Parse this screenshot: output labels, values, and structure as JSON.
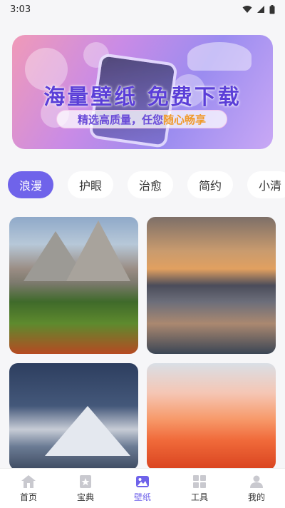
{
  "status": {
    "time": "3:03"
  },
  "banner": {
    "title": "海量壁纸 免费下载",
    "subtitle_main": "精选高质量，任您",
    "subtitle_highlight": "随心畅享"
  },
  "tabs": [
    {
      "label": "浪漫",
      "active": true
    },
    {
      "label": "护眼",
      "active": false
    },
    {
      "label": "治愈",
      "active": false
    },
    {
      "label": "简约",
      "active": false
    },
    {
      "label": "小清",
      "active": false
    }
  ],
  "bottom_nav": [
    {
      "label": "首页",
      "icon": "home-icon"
    },
    {
      "label": "宝典",
      "icon": "book-icon"
    },
    {
      "label": "壁纸",
      "icon": "image-icon",
      "active": true
    },
    {
      "label": "工具",
      "icon": "grid-icon"
    },
    {
      "label": "我的",
      "icon": "user-icon"
    }
  ],
  "colors": {
    "accent": "#6f63ea",
    "highlight": "#f09a2a"
  }
}
